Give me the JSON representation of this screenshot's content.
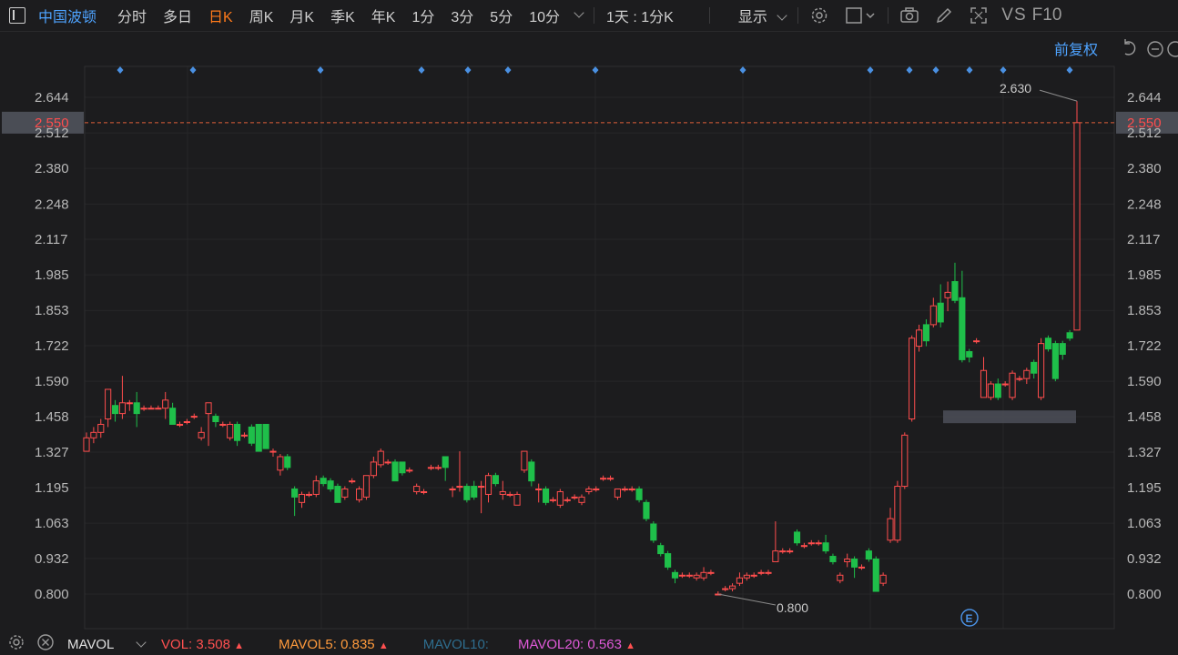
{
  "toolbar": {
    "stock_name": "中国波顿",
    "tabs": [
      "分时",
      "多日",
      "日K",
      "周K",
      "月K",
      "季K",
      "年K",
      "1分",
      "3分",
      "5分",
      "10分"
    ],
    "active_tab": "日K",
    "period_select": "1天 : 1分K",
    "display_label": "显示",
    "vs_label": "VS",
    "f10_label": "F10"
  },
  "chart_header": {
    "adjust_label": "前复权"
  },
  "current_price": "2.550",
  "annotations": {
    "high_label": "2.630",
    "low_label": "0.800",
    "event_marker": "E"
  },
  "footer": {
    "indicator": "MAVOL",
    "vol_label": "VOL:",
    "vol_value": "3.508",
    "mavol5_label": "MAVOL5:",
    "mavol5_value": "0.835",
    "mavol10_label": "MAVOL10:",
    "mavol20_label": "MAVOL20:",
    "mavol20_value": "0.563",
    "arrow": "▲"
  },
  "colors": {
    "up": "#ff4d4d",
    "down": "#1fbf4a",
    "active_tab": "#ff7a1a",
    "stock_name": "#4ea3ff",
    "marker": "#4a90e2",
    "vol": "#ff5050",
    "mavol5": "#ff9a3c",
    "mavol10": "#2e6d8e",
    "mavol20": "#e05ad8"
  },
  "chart_data": {
    "type": "candlestick",
    "y_ticks": [
      "2.644",
      "2.512",
      "2.380",
      "2.248",
      "2.117",
      "1.985",
      "1.853",
      "1.722",
      "1.590",
      "1.458",
      "1.327",
      "1.195",
      "1.063",
      "0.932",
      "0.800"
    ],
    "ylim": [
      0.75,
      2.7
    ],
    "current_price": 2.55,
    "candles": [
      {
        "o": 1.33,
        "c": 1.38,
        "h": 1.4,
        "l": 1.33
      },
      {
        "o": 1.38,
        "c": 1.4,
        "h": 1.42,
        "l": 1.36
      },
      {
        "o": 1.4,
        "c": 1.43,
        "h": 1.45,
        "l": 1.38
      },
      {
        "o": 1.45,
        "c": 1.56,
        "h": 1.56,
        "l": 1.42
      },
      {
        "o": 1.5,
        "c": 1.47,
        "h": 1.52,
        "l": 1.44
      },
      {
        "o": 1.47,
        "c": 1.51,
        "h": 1.61,
        "l": 1.45
      },
      {
        "o": 1.51,
        "c": 1.51,
        "h": 1.52,
        "l": 1.48
      },
      {
        "o": 1.51,
        "c": 1.47,
        "h": 1.55,
        "l": 1.42
      },
      {
        "o": 1.49,
        "c": 1.49,
        "h": 1.5,
        "l": 1.48
      },
      {
        "o": 1.49,
        "c": 1.49,
        "h": 1.5,
        "l": 1.49
      },
      {
        "o": 1.49,
        "c": 1.49,
        "h": 1.5,
        "l": 1.49
      },
      {
        "o": 1.49,
        "c": 1.52,
        "h": 1.55,
        "l": 1.45
      },
      {
        "o": 1.49,
        "c": 1.43,
        "h": 1.51,
        "l": 1.43
      },
      {
        "o": 1.43,
        "c": 1.43,
        "h": 1.44,
        "l": 1.42
      },
      {
        "o": 1.44,
        "c": 1.44,
        "h": 1.45,
        "l": 1.43
      },
      {
        "o": 1.46,
        "c": 1.46,
        "h": 1.47,
        "l": 1.45
      },
      {
        "o": 1.38,
        "c": 1.4,
        "h": 1.42,
        "l": 1.37
      },
      {
        "o": 1.47,
        "c": 1.51,
        "h": 1.51,
        "l": 1.35
      },
      {
        "o": 1.46,
        "c": 1.44,
        "h": 1.47,
        "l": 1.42
      },
      {
        "o": 1.43,
        "c": 1.43,
        "h": 1.44,
        "l": 1.42
      },
      {
        "o": 1.38,
        "c": 1.43,
        "h": 1.44,
        "l": 1.37
      },
      {
        "o": 1.43,
        "c": 1.37,
        "h": 1.44,
        "l": 1.35
      },
      {
        "o": 1.39,
        "c": 1.39,
        "h": 1.4,
        "l": 1.38
      },
      {
        "o": 1.42,
        "c": 1.36,
        "h": 1.43,
        "l": 1.35
      },
      {
        "o": 1.43,
        "c": 1.33,
        "h": 1.43,
        "l": 1.33
      },
      {
        "o": 1.43,
        "c": 1.34,
        "h": 1.43,
        "l": 1.34
      },
      {
        "o": 1.33,
        "c": 1.33,
        "h": 1.34,
        "l": 1.31
      },
      {
        "o": 1.26,
        "c": 1.31,
        "h": 1.32,
        "l": 1.24
      },
      {
        "o": 1.31,
        "c": 1.27,
        "h": 1.32,
        "l": 1.26
      },
      {
        "o": 1.19,
        "c": 1.16,
        "h": 1.2,
        "l": 1.09
      },
      {
        "o": 1.14,
        "c": 1.17,
        "h": 1.18,
        "l": 1.12
      },
      {
        "o": 1.17,
        "c": 1.17,
        "h": 1.18,
        "l": 1.16
      },
      {
        "o": 1.17,
        "c": 1.22,
        "h": 1.24,
        "l": 1.16
      },
      {
        "o": 1.23,
        "c": 1.21,
        "h": 1.24,
        "l": 1.2
      },
      {
        "o": 1.22,
        "c": 1.19,
        "h": 1.23,
        "l": 1.18
      },
      {
        "o": 1.2,
        "c": 1.14,
        "h": 1.21,
        "l": 1.14
      },
      {
        "o": 1.16,
        "c": 1.19,
        "h": 1.2,
        "l": 1.15
      },
      {
        "o": 1.22,
        "c": 1.22,
        "h": 1.23,
        "l": 1.21
      },
      {
        "o": 1.15,
        "c": 1.19,
        "h": 1.2,
        "l": 1.14
      },
      {
        "o": 1.16,
        "c": 1.24,
        "h": 1.24,
        "l": 1.15
      },
      {
        "o": 1.24,
        "c": 1.29,
        "h": 1.31,
        "l": 1.23
      },
      {
        "o": 1.28,
        "c": 1.33,
        "h": 1.34,
        "l": 1.27
      },
      {
        "o": 1.29,
        "c": 1.29,
        "h": 1.3,
        "l": 1.28
      },
      {
        "o": 1.29,
        "c": 1.22,
        "h": 1.3,
        "l": 1.22
      },
      {
        "o": 1.29,
        "c": 1.25,
        "h": 1.29,
        "l": 1.24
      },
      {
        "o": 1.26,
        "c": 1.26,
        "h": 1.27,
        "l": 1.25
      },
      {
        "o": 1.18,
        "c": 1.2,
        "h": 1.21,
        "l": 1.17
      },
      {
        "o": 1.18,
        "c": 1.18,
        "h": 1.19,
        "l": 1.17
      },
      {
        "o": 1.27,
        "c": 1.27,
        "h": 1.28,
        "l": 1.26
      },
      {
        "o": 1.27,
        "c": 1.27,
        "h": 1.28,
        "l": 1.26
      },
      {
        "o": 1.31,
        "c": 1.27,
        "h": 1.31,
        "l": 1.22
      },
      {
        "o": 1.19,
        "c": 1.19,
        "h": 1.2,
        "l": 1.16
      },
      {
        "o": 1.2,
        "c": 1.2,
        "h": 1.33,
        "l": 1.18
      },
      {
        "o": 1.2,
        "c": 1.15,
        "h": 1.21,
        "l": 1.14
      },
      {
        "o": 1.2,
        "c": 1.16,
        "h": 1.22,
        "l": 1.15
      },
      {
        "o": 1.2,
        "c": 1.2,
        "h": 1.22,
        "l": 1.1
      },
      {
        "o": 1.17,
        "c": 1.24,
        "h": 1.25,
        "l": 1.14
      },
      {
        "o": 1.24,
        "c": 1.21,
        "h": 1.25,
        "l": 1.2
      },
      {
        "o": 1.17,
        "c": 1.18,
        "h": 1.22,
        "l": 1.15
      },
      {
        "o": 1.17,
        "c": 1.17,
        "h": 1.18,
        "l": 1.16
      },
      {
        "o": 1.13,
        "c": 1.17,
        "h": 1.18,
        "l": 1.13
      },
      {
        "o": 1.26,
        "c": 1.33,
        "h": 1.33,
        "l": 1.25
      },
      {
        "o": 1.29,
        "c": 1.22,
        "h": 1.3,
        "l": 1.2
      },
      {
        "o": 1.19,
        "c": 1.19,
        "h": 1.21,
        "l": 1.14
      },
      {
        "o": 1.19,
        "c": 1.14,
        "h": 1.2,
        "l": 1.13
      },
      {
        "o": 1.15,
        "c": 1.15,
        "h": 1.16,
        "l": 1.14
      },
      {
        "o": 1.13,
        "c": 1.18,
        "h": 1.19,
        "l": 1.12
      },
      {
        "o": 1.15,
        "c": 1.15,
        "h": 1.16,
        "l": 1.14
      },
      {
        "o": 1.16,
        "c": 1.16,
        "h": 1.17,
        "l": 1.15
      },
      {
        "o": 1.14,
        "c": 1.16,
        "h": 1.17,
        "l": 1.13
      },
      {
        "o": 1.18,
        "c": 1.19,
        "h": 1.2,
        "l": 1.17
      },
      {
        "o": 1.19,
        "c": 1.19,
        "h": 1.2,
        "l": 1.18
      },
      {
        "o": 1.23,
        "c": 1.23,
        "h": 1.24,
        "l": 1.22
      },
      {
        "o": 1.23,
        "c": 1.23,
        "h": 1.24,
        "l": 1.22
      },
      {
        "o": 1.16,
        "c": 1.19,
        "h": 1.19,
        "l": 1.15
      },
      {
        "o": 1.19,
        "c": 1.19,
        "h": 1.2,
        "l": 1.18
      },
      {
        "o": 1.19,
        "c": 1.19,
        "h": 1.2,
        "l": 1.18
      },
      {
        "o": 1.19,
        "c": 1.15,
        "h": 1.2,
        "l": 1.14
      },
      {
        "o": 1.14,
        "c": 1.08,
        "h": 1.15,
        "l": 1.07
      },
      {
        "o": 1.06,
        "c": 1.0,
        "h": 1.07,
        "l": 0.99
      },
      {
        "o": 0.98,
        "c": 0.95,
        "h": 0.99,
        "l": 0.94
      },
      {
        "o": 0.95,
        "c": 0.9,
        "h": 0.96,
        "l": 0.89
      },
      {
        "o": 0.88,
        "c": 0.86,
        "h": 0.89,
        "l": 0.84
      },
      {
        "o": 0.87,
        "c": 0.87,
        "h": 0.88,
        "l": 0.86
      },
      {
        "o": 0.87,
        "c": 0.87,
        "h": 0.88,
        "l": 0.86
      },
      {
        "o": 0.86,
        "c": 0.87,
        "h": 0.88,
        "l": 0.85
      },
      {
        "o": 0.86,
        "c": 0.88,
        "h": 0.9,
        "l": 0.85
      },
      {
        "o": 0.88,
        "c": 0.88,
        "h": 0.89,
        "l": 0.87
      },
      {
        "o": 0.8,
        "c": 0.8,
        "h": 0.81,
        "l": 0.8
      },
      {
        "o": 0.82,
        "c": 0.82,
        "h": 0.83,
        "l": 0.81
      },
      {
        "o": 0.82,
        "c": 0.83,
        "h": 0.84,
        "l": 0.81
      },
      {
        "o": 0.84,
        "c": 0.86,
        "h": 0.88,
        "l": 0.83
      },
      {
        "o": 0.86,
        "c": 0.87,
        "h": 0.88,
        "l": 0.85
      },
      {
        "o": 0.87,
        "c": 0.87,
        "h": 0.88,
        "l": 0.86
      },
      {
        "o": 0.88,
        "c": 0.88,
        "h": 0.89,
        "l": 0.87
      },
      {
        "o": 0.88,
        "c": 0.88,
        "h": 0.89,
        "l": 0.87
      },
      {
        "o": 0.92,
        "c": 0.96,
        "h": 1.07,
        "l": 0.92
      },
      {
        "o": 0.96,
        "c": 0.96,
        "h": 0.97,
        "l": 0.95
      },
      {
        "o": 0.96,
        "c": 0.96,
        "h": 0.97,
        "l": 0.95
      },
      {
        "o": 1.03,
        "c": 0.99,
        "h": 1.04,
        "l": 0.98
      },
      {
        "o": 0.98,
        "c": 0.98,
        "h": 0.99,
        "l": 0.97
      },
      {
        "o": 0.99,
        "c": 0.99,
        "h": 1.0,
        "l": 0.98
      },
      {
        "o": 0.99,
        "c": 0.99,
        "h": 1.0,
        "l": 0.98
      },
      {
        "o": 0.99,
        "c": 0.96,
        "h": 1.02,
        "l": 0.95
      },
      {
        "o": 0.94,
        "c": 0.92,
        "h": 0.95,
        "l": 0.91
      },
      {
        "o": 0.85,
        "c": 0.87,
        "h": 0.88,
        "l": 0.84
      },
      {
        "o": 0.92,
        "c": 0.93,
        "h": 0.95,
        "l": 0.9
      },
      {
        "o": 0.93,
        "c": 0.9,
        "h": 0.94,
        "l": 0.86
      },
      {
        "o": 0.9,
        "c": 0.9,
        "h": 0.91,
        "l": 0.89
      },
      {
        "o": 0.96,
        "c": 0.93,
        "h": 0.97,
        "l": 0.92
      },
      {
        "o": 0.93,
        "c": 0.81,
        "h": 0.94,
        "l": 0.81
      },
      {
        "o": 0.84,
        "c": 0.87,
        "h": 0.88,
        "l": 0.83
      },
      {
        "o": 1.0,
        "c": 1.08,
        "h": 1.12,
        "l": 0.99
      },
      {
        "o": 1.0,
        "c": 1.2,
        "h": 1.22,
        "l": 0.99
      },
      {
        "o": 1.2,
        "c": 1.39,
        "h": 1.4,
        "l": 1.19
      },
      {
        "o": 1.45,
        "c": 1.75,
        "h": 1.76,
        "l": 1.44
      },
      {
        "o": 1.72,
        "c": 1.78,
        "h": 1.8,
        "l": 1.7
      },
      {
        "o": 1.8,
        "c": 1.74,
        "h": 1.82,
        "l": 1.72
      },
      {
        "o": 1.8,
        "c": 1.87,
        "h": 1.9,
        "l": 1.79
      },
      {
        "o": 1.88,
        "c": 1.81,
        "h": 1.95,
        "l": 1.79
      },
      {
        "o": 1.9,
        "c": 1.92,
        "h": 1.96,
        "l": 1.85
      },
      {
        "o": 1.96,
        "c": 1.89,
        "h": 2.03,
        "l": 1.88
      },
      {
        "o": 1.9,
        "c": 1.67,
        "h": 2.0,
        "l": 1.66
      },
      {
        "o": 1.7,
        "c": 1.68,
        "h": 1.71,
        "l": 1.66
      },
      {
        "o": 1.74,
        "c": 1.74,
        "h": 1.75,
        "l": 1.73
      },
      {
        "o": 1.53,
        "c": 1.63,
        "h": 1.68,
        "l": 1.53
      },
      {
        "o": 1.53,
        "c": 1.58,
        "h": 1.59,
        "l": 1.52
      },
      {
        "o": 1.58,
        "c": 1.53,
        "h": 1.6,
        "l": 1.52
      },
      {
        "o": 1.58,
        "c": 1.58,
        "h": 1.59,
        "l": 1.57
      },
      {
        "o": 1.53,
        "c": 1.62,
        "h": 1.63,
        "l": 1.52
      },
      {
        "o": 1.6,
        "c": 1.6,
        "h": 1.61,
        "l": 1.59
      },
      {
        "o": 1.6,
        "c": 1.63,
        "h": 1.64,
        "l": 1.58
      },
      {
        "o": 1.66,
        "c": 1.62,
        "h": 1.67,
        "l": 1.6
      },
      {
        "o": 1.53,
        "c": 1.73,
        "h": 1.75,
        "l": 1.52
      },
      {
        "o": 1.75,
        "c": 1.71,
        "h": 1.76,
        "l": 1.7
      },
      {
        "o": 1.73,
        "c": 1.6,
        "h": 1.74,
        "l": 1.59
      },
      {
        "o": 1.73,
        "c": 1.69,
        "h": 1.74,
        "l": 1.67
      },
      {
        "o": 1.77,
        "c": 1.75,
        "h": 1.78,
        "l": 1.74
      },
      {
        "o": 1.78,
        "c": 2.55,
        "h": 2.63,
        "l": 1.78
      }
    ],
    "high": 2.63,
    "low": 0.8
  }
}
